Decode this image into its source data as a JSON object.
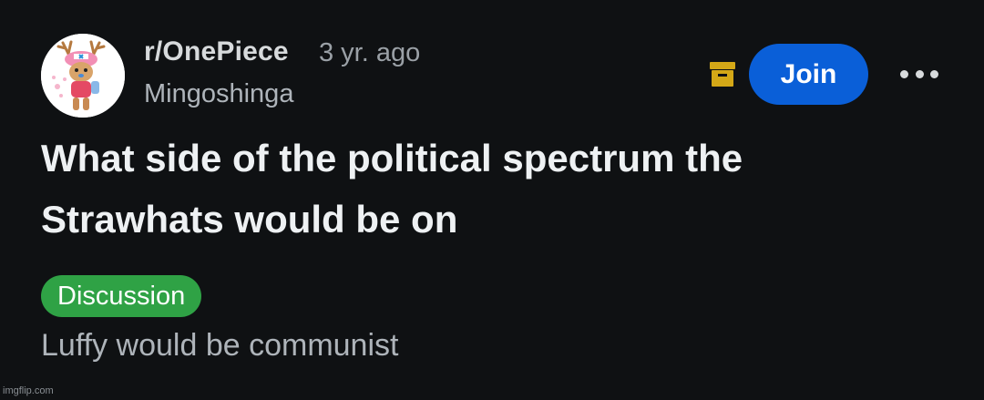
{
  "post": {
    "subreddit": "r/OnePiece",
    "age": "3 yr. ago",
    "author": "Mingoshinga",
    "title": "What side of the political spectrum the Strawhats would be on",
    "flair": "Discussion",
    "body": "Luffy would be communist"
  },
  "actions": {
    "join_label": "Join",
    "archive_icon": "archive-icon",
    "more_icon": "more-horizontal-icon"
  },
  "colors": {
    "background": "#0f1113",
    "join_button": "#0a5fd8",
    "flair": "#2fa245",
    "archive_icon": "#d4a817"
  },
  "watermark": "imgflip.com"
}
